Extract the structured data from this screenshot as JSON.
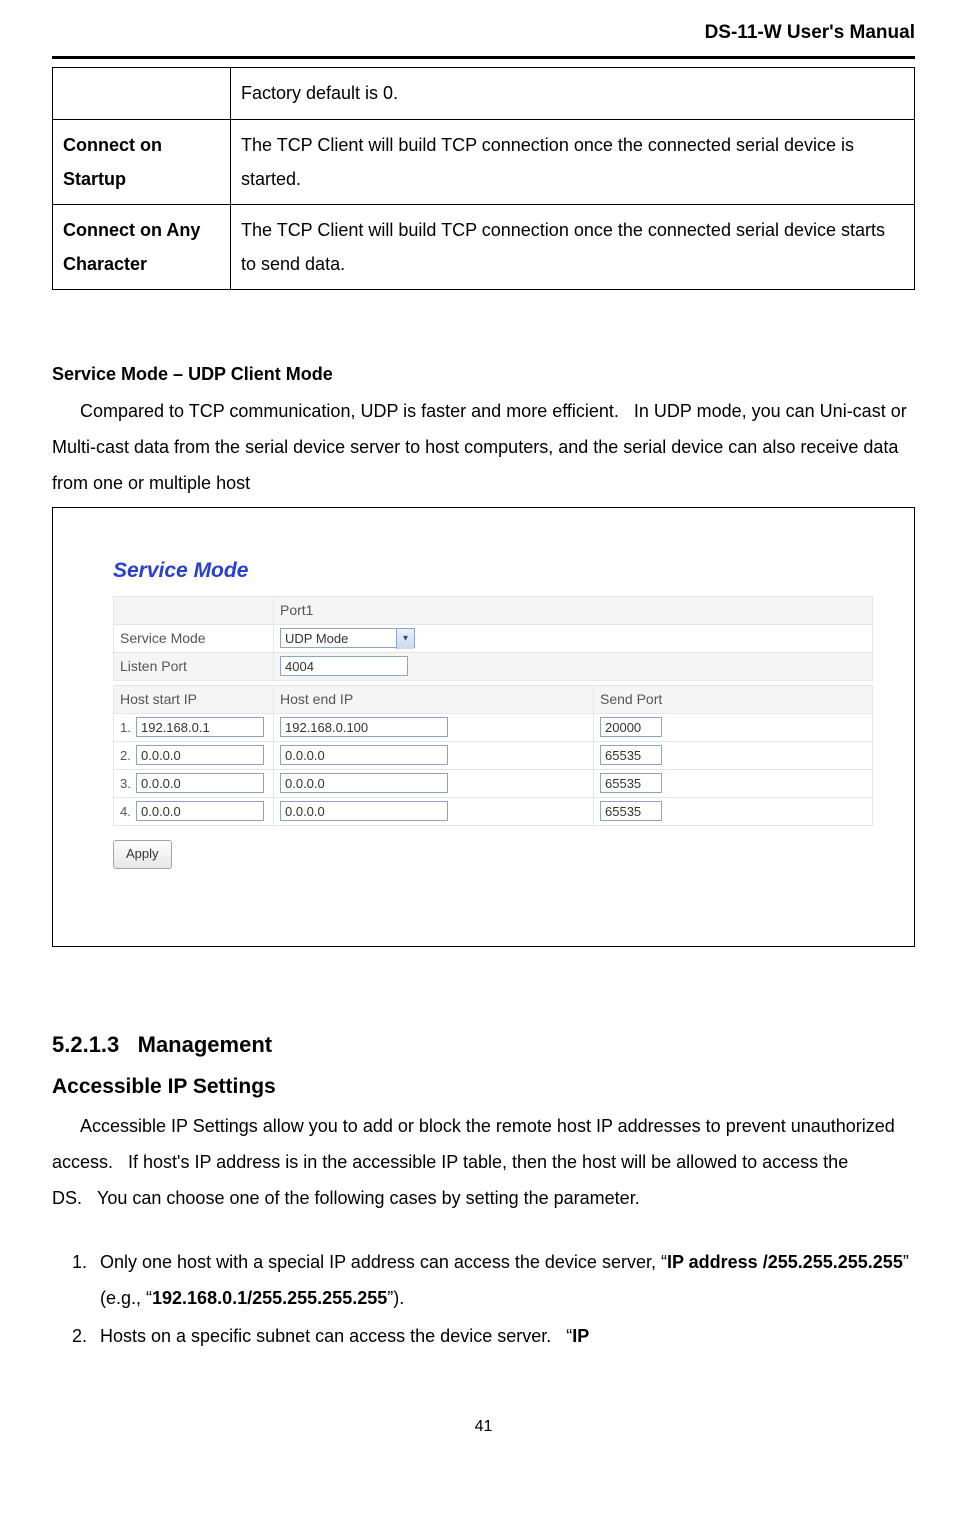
{
  "doc_header": "DS-11-W User's Manual",
  "page_number": "41",
  "outer_table": {
    "row0_desc": "Factory default is 0.",
    "row1_label": "Connect on Startup",
    "row1_desc": "The TCP Client will build TCP connection once the connected serial device is started.",
    "row2_label": "Connect on Any Character",
    "row2_desc": "The TCP Client will build TCP connection once the connected serial device starts to send data."
  },
  "udp_section": {
    "title": "Service Mode – UDP Client Mode",
    "para": "Compared to TCP communication, UDP is faster and more efficient.   In UDP mode, you can Uni-cast or Multi-cast data from the serial device server to host computers, and the serial device can also receive data from one or multiple host"
  },
  "ui": {
    "title": "Service Mode",
    "port_col": "Port1",
    "service_mode_label": "Service Mode",
    "service_mode_value": "UDP Mode",
    "listen_port_label": "Listen Port",
    "listen_port_value": "4004",
    "cols": {
      "start": "Host start IP",
      "end": "Host end IP",
      "send": "Send Port"
    },
    "rows": [
      {
        "n": "1.",
        "start": "192.168.0.1",
        "end": "192.168.0.100",
        "send": "20000"
      },
      {
        "n": "2.",
        "start": "0.0.0.0",
        "end": "0.0.0.0",
        "send": "65535"
      },
      {
        "n": "3.",
        "start": "0.0.0.0",
        "end": "0.0.0.0",
        "send": "65535"
      },
      {
        "n": "4.",
        "start": "0.0.0.0",
        "end": "0.0.0.0",
        "send": "65535"
      }
    ],
    "apply": "Apply"
  },
  "mgmt": {
    "h3": "5.2.1.3   Management",
    "h4": "Accessible IP Settings",
    "para": "Accessible IP Settings allow you to add or block the remote host IP addresses to prevent unauthorized access.   If host's IP address is in the accessible IP table, then the host will be allowed to access the DS.   You can choose one of the following cases by setting the parameter.",
    "li1_pre": "Only one host with a special IP address can access the device server, “",
    "li1_b1": "IP address /255.255.255.255",
    "li1_mid": "” (e.g., “",
    "li1_b2": "192.168.0.1/255.255.255.255",
    "li1_post": "”).",
    "li2_pre": "Hosts on a specific subnet can access the device server.   “",
    "li2_b1": "IP"
  }
}
